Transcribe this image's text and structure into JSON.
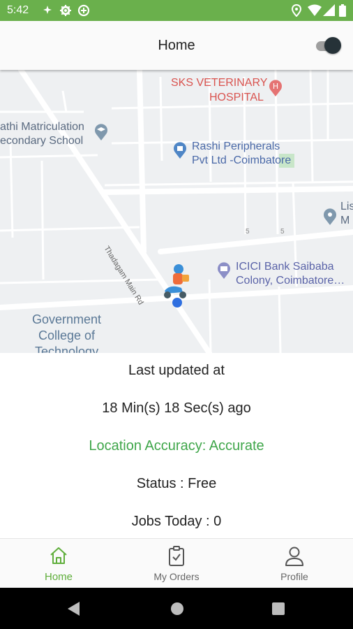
{
  "status_bar": {
    "time": "5:42"
  },
  "app_bar": {
    "title": "Home",
    "toggle_on": true
  },
  "map": {
    "labels": {
      "sks_line1": "SKS VETERINARY",
      "sks_line2": "HOSPITAL",
      "school_line1": "athi Matriculation",
      "school_line2": "econdary School",
      "rashi_line1": "Rashi Peripherals",
      "rashi_line2": "Pvt Ltd -Coimbatore",
      "lis_line1": "Lis",
      "lis_line2": "M",
      "road": "Thadagam Main Rd",
      "icici_line1": "ICICI Bank Saibaba",
      "icici_line2": "Colony, Coimbatore…",
      "gct_line1": "Government",
      "gct_line2": "College of",
      "gct_line3": "Technology",
      "street_num1": "5",
      "street_num2": "5"
    }
  },
  "info": {
    "last_updated_label": "Last updated at",
    "elapsed": "18 Min(s) 18 Sec(s) ago",
    "accuracy": "Location Accuracy: Accurate",
    "status": "Status : Free",
    "jobs_today": "Jobs Today : 0"
  },
  "bottom_nav": {
    "items": [
      {
        "label": "Home",
        "icon": "home-icon",
        "active": true
      },
      {
        "label": "My Orders",
        "icon": "clipboard-check-icon",
        "active": false
      },
      {
        "label": "Profile",
        "icon": "person-icon",
        "active": false
      }
    ]
  },
  "colors": {
    "brand_green": "#6ab04c",
    "accent_green": "#5fae3b",
    "accuracy_green": "#3fa64a"
  }
}
